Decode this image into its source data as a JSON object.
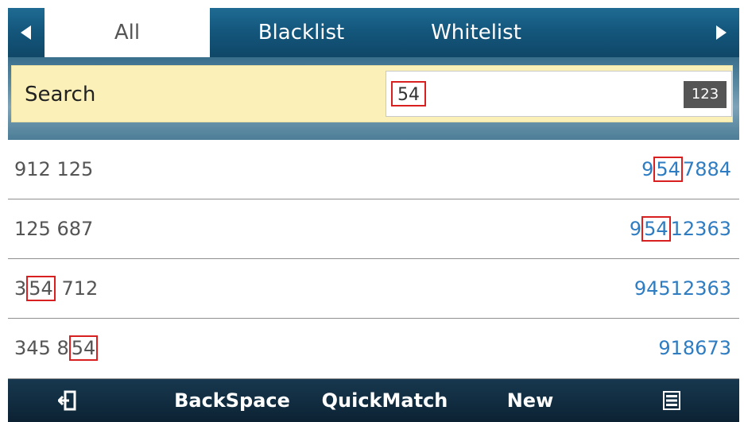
{
  "tabs": [
    {
      "label": "All",
      "active": true
    },
    {
      "label": "Blacklist",
      "active": false
    },
    {
      "label": "Whitelist",
      "active": false
    }
  ],
  "nav_icons": {
    "left": "triangle-left-icon",
    "right": "triangle-right-icon"
  },
  "search": {
    "label": "Search",
    "value": "54",
    "input_mode": "123"
  },
  "contacts": [
    {
      "name_pre": "912 125",
      "name_match": "",
      "name_post": "",
      "num_pre": "9",
      "num_match": "54",
      "num_post": "7884"
    },
    {
      "name_pre": "125 687",
      "name_match": "",
      "name_post": "",
      "num_pre": "9",
      "num_match": "54",
      "num_post": "12363"
    },
    {
      "name_pre": "3",
      "name_match": "54",
      "name_post": " 712",
      "num_pre": "94512363",
      "num_match": "",
      "num_post": ""
    },
    {
      "name_pre": "345 8",
      "name_match": "54",
      "name_post": "",
      "num_pre": "918673",
      "num_match": "",
      "num_post": ""
    }
  ],
  "softkeys": {
    "back_icon": "exit-icon",
    "backspace": "BackSpace",
    "quickmatch": "QuickMatch",
    "new": "New",
    "menu_icon": "menu-icon"
  },
  "colors": {
    "tab_bar": "#14577d",
    "search_row": "#fbf0b8",
    "number_text": "#2e7cc2",
    "highlight_border": "#d82020",
    "softkey_bar": "#0c2233"
  }
}
